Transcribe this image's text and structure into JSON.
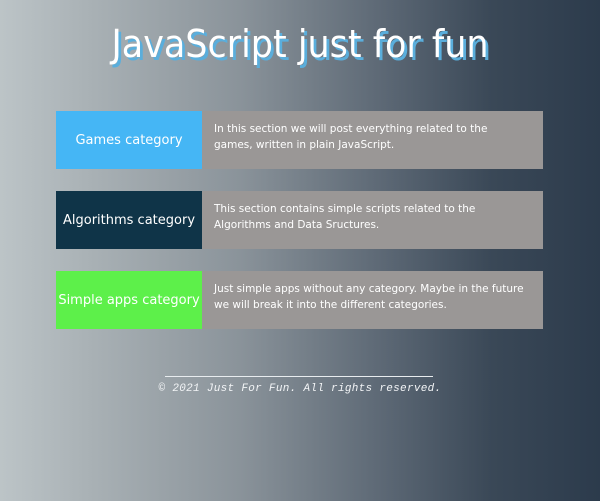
{
  "header": {
    "title": "JavaScript just for fun"
  },
  "categories": [
    {
      "label": "Games category",
      "description": "In this section we will post everything related to the games, written in plain JavaScript.",
      "color": "#45b6f5"
    },
    {
      "label": "Algorithms category",
      "description": "This section contains simple scripts related to the Algorithms and Data Sructures.",
      "color": "#0f3448"
    },
    {
      "label": "Simple apps category",
      "description": "Just simple apps without any category. Maybe in the future we will break it into the different categories.",
      "color": "#5df04a"
    }
  ],
  "footer": {
    "copyright": "© 2021 Just For Fun. All rights reserved."
  },
  "colors": {
    "description_background": "#9a9796",
    "title_shadow": "#5aaedc"
  }
}
